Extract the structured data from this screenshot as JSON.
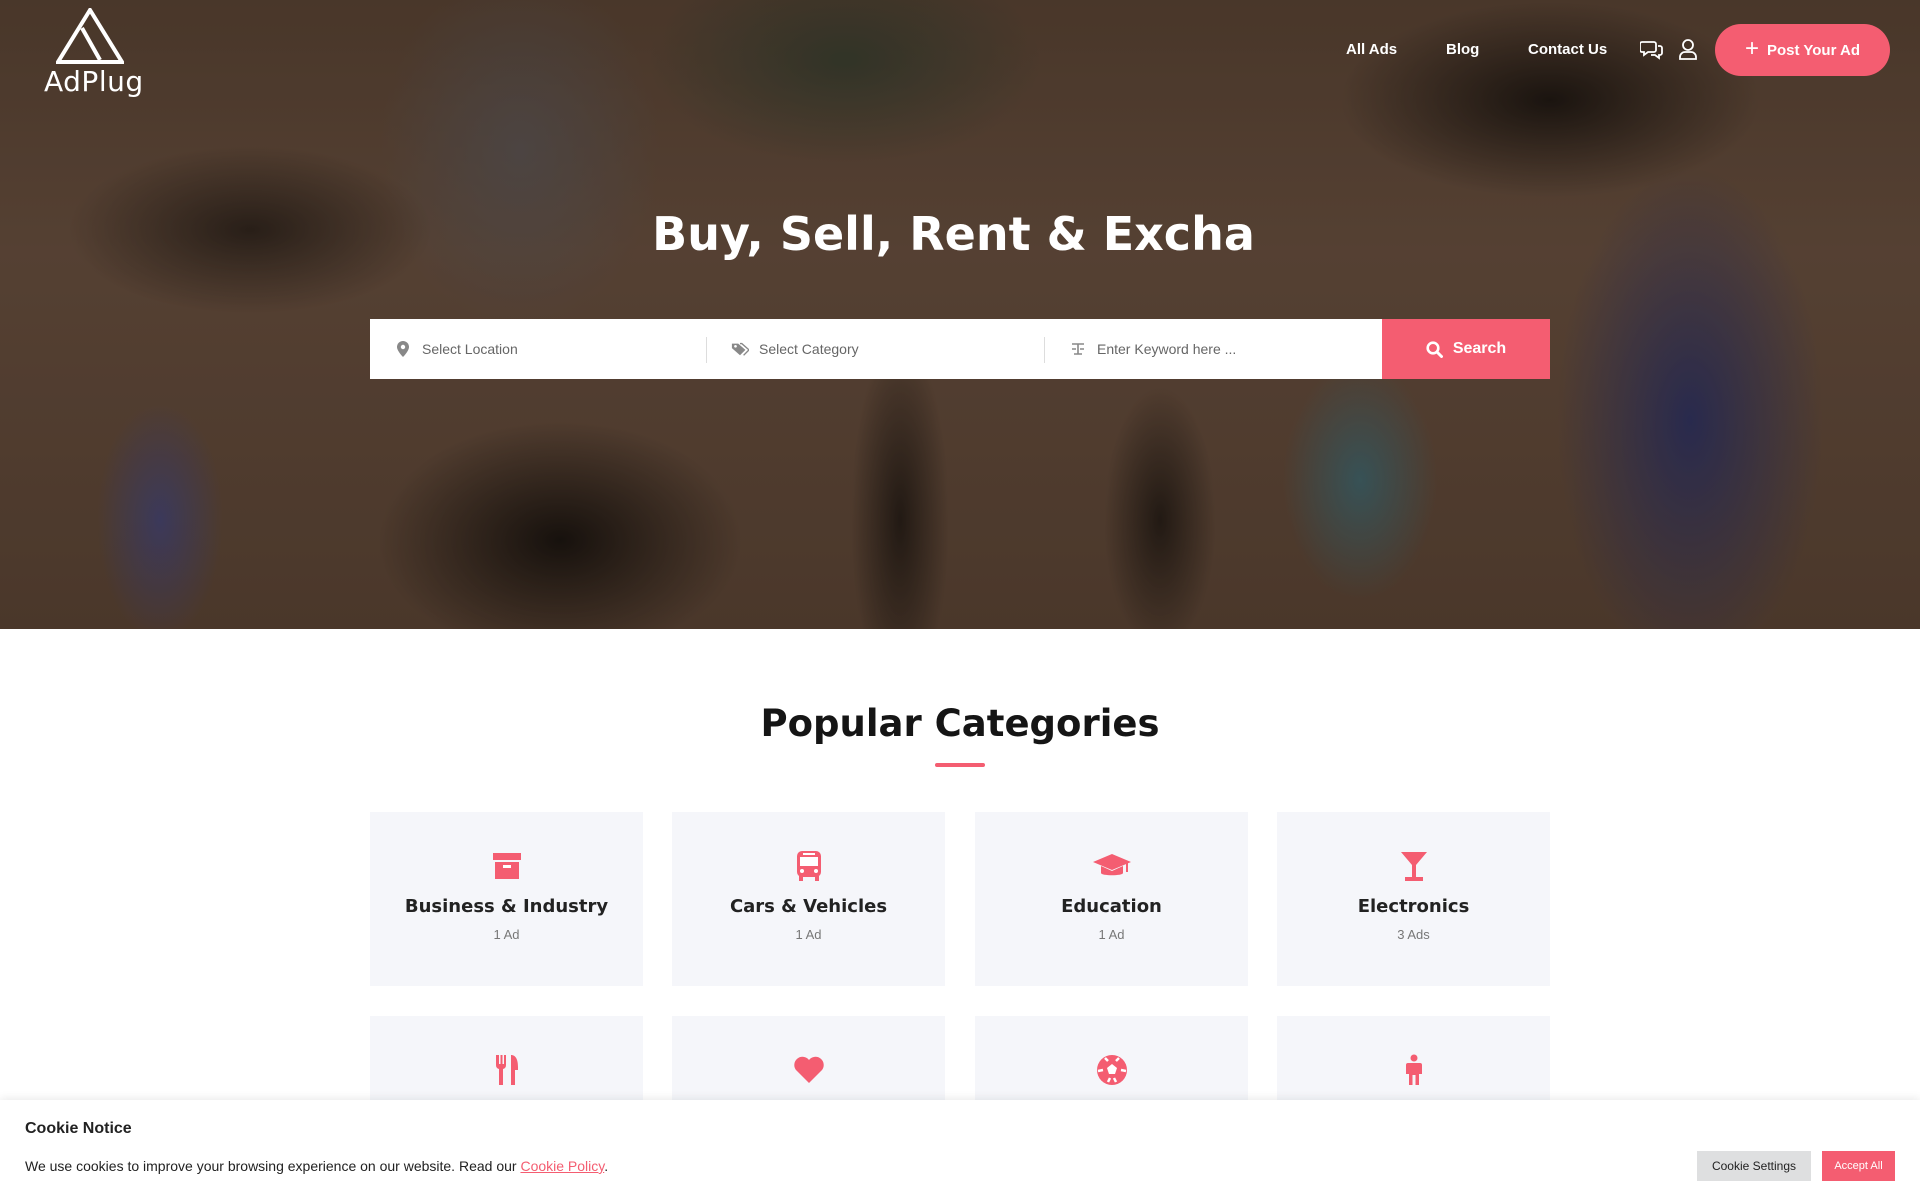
{
  "brand": {
    "name": "AdPlug",
    "accent": "#f45d71"
  },
  "nav": {
    "links": [
      "All Ads",
      "Blog",
      "Contact Us"
    ],
    "post_ad_label": "Post Your Ad"
  },
  "hero": {
    "title": "Buy, Sell, Rent & Excha"
  },
  "search": {
    "location_placeholder": "Select Location",
    "category_placeholder": "Select Category",
    "keyword_placeholder": "Enter Keyword here ...",
    "button_label": "Search"
  },
  "categories": {
    "title": "Popular Categories",
    "items": [
      {
        "name": "Business & Industry",
        "count": "1 Ad",
        "icon": "archive-box-icon"
      },
      {
        "name": "Cars & Vehicles",
        "count": "1 Ad",
        "icon": "bus-icon"
      },
      {
        "name": "Education",
        "count": "1 Ad",
        "icon": "graduation-cap-icon"
      },
      {
        "name": "Electronics",
        "count": "3 Ads",
        "icon": "cocktail-glass-icon"
      },
      {
        "name": "",
        "count": "",
        "icon": "fork-knife-icon"
      },
      {
        "name": "",
        "count": "",
        "icon": "heart-icon"
      },
      {
        "name": "",
        "count": "",
        "icon": "soccer-ball-icon"
      },
      {
        "name": "",
        "count": "",
        "icon": "person-icon"
      }
    ]
  },
  "cookie": {
    "title": "Cookie Notice",
    "text": "We use cookies to improve your browsing experience on our website. Read our ",
    "link": "Cookie Policy",
    "end": ".",
    "settings_label": "Cookie Settings",
    "accept_label": "Accept All"
  }
}
